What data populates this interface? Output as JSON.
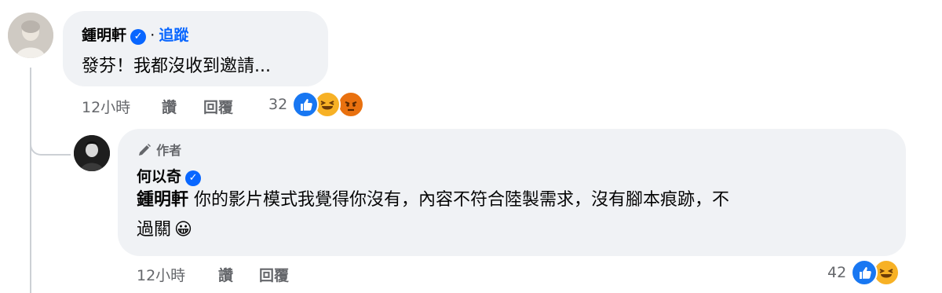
{
  "comment": {
    "author": "鍾明軒",
    "separator": "·",
    "follow_label": "追蹤",
    "text": "發芬！我都沒收到邀請...",
    "time": "12小時",
    "like_label": "讚",
    "reply_label": "回覆",
    "reaction_count": "32",
    "reactions": [
      "like-icon",
      "haha-icon",
      "angry-icon"
    ]
  },
  "reply": {
    "badge": "作者",
    "author": "何以奇",
    "mention": "鍾明軒",
    "text_line1": " 你的影片模式我覺得你沒有，內容不符合陸製需求，沒有腳本痕跡，不",
    "text_line2": "過關",
    "emoji": "😀",
    "time": "12小時",
    "like_label": "讚",
    "reply_label": "回覆",
    "reaction_count": "42",
    "reactions": [
      "like-icon",
      "haha-icon"
    ]
  },
  "colors": {
    "bubble_bg": "#f0f2f5",
    "link_blue": "#0866ff",
    "meta_gray": "#65676b",
    "angry": "#e9710f",
    "haha": "#f7b125"
  }
}
